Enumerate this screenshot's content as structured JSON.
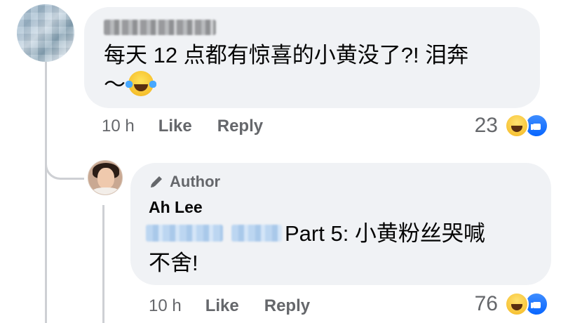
{
  "comment": {
    "avatar_alt": "blurred avatar",
    "author_name_blurred": true,
    "text_line1": "每天 12 点都有惊喜的小黄没了?!  泪奔",
    "text_line2": "～",
    "emoji": "laugh-cry-icon",
    "time": "10 h",
    "like_label": "Like",
    "reply_label": "Reply",
    "reaction_count": "23",
    "reactions": [
      "haha-icon",
      "like-icon"
    ]
  },
  "reply": {
    "badge_label": "Author",
    "author_name": "Ah Lee",
    "mention_blurred": true,
    "text_line1": "Part 5: 小黄粉丝哭喊",
    "text_line2": "不舍!",
    "time": "10 h",
    "like_label": "Like",
    "reply_label": "Reply",
    "reaction_count": "76",
    "reactions": [
      "haha-icon",
      "like-icon"
    ]
  },
  "colors": {
    "bubble": "#f0f2f5",
    "meta": "#65676b",
    "like_blue": "#0866ff",
    "haha_yellow": "#f7c234",
    "thread_line": "#ced0d4"
  }
}
